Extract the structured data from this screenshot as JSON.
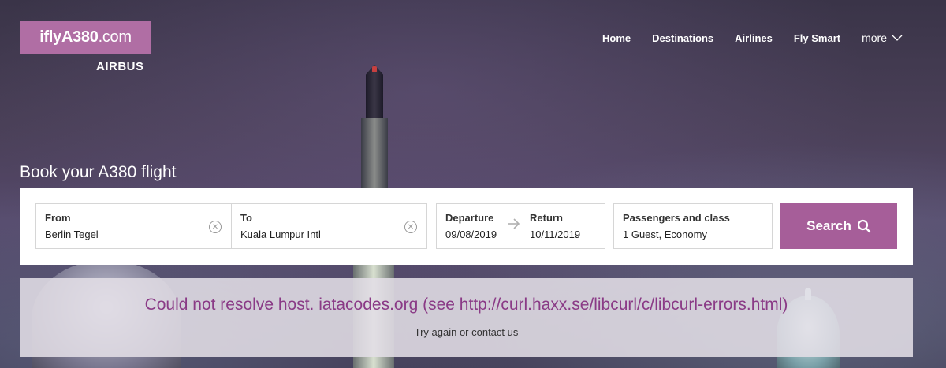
{
  "logo": {
    "bold": "iflyA380",
    "rest": ".com",
    "brand": "AIRBUS"
  },
  "nav": {
    "items": [
      {
        "label": "Home"
      },
      {
        "label": "Destinations"
      },
      {
        "label": "Airlines"
      },
      {
        "label": "Fly Smart"
      }
    ],
    "more_label": "more"
  },
  "booking": {
    "title": "Book your A380 flight",
    "from": {
      "label": "From",
      "value": "Berlin Tegel"
    },
    "to": {
      "label": "To",
      "value": "Kuala Lumpur Intl"
    },
    "departure": {
      "label": "Departure",
      "value": "09/08/2019"
    },
    "return": {
      "label": "Return",
      "value": "10/11/2019"
    },
    "passengers": {
      "label": "Passengers and class",
      "value": "1 Guest, Economy"
    },
    "search_label": "Search"
  },
  "error": {
    "message": "Could not resolve host. iatacodes.org (see http://curl.haxx.se/libcurl/c/libcurl-errors.html)",
    "sub": "Try again or contact us"
  },
  "colors": {
    "accent": "#a65e99",
    "logo_bg": "#b06ea4",
    "error_text": "#8a3a86"
  },
  "icons": [
    "clear-icon",
    "arrow-right-icon",
    "search-icon",
    "chevron-down-icon"
  ]
}
